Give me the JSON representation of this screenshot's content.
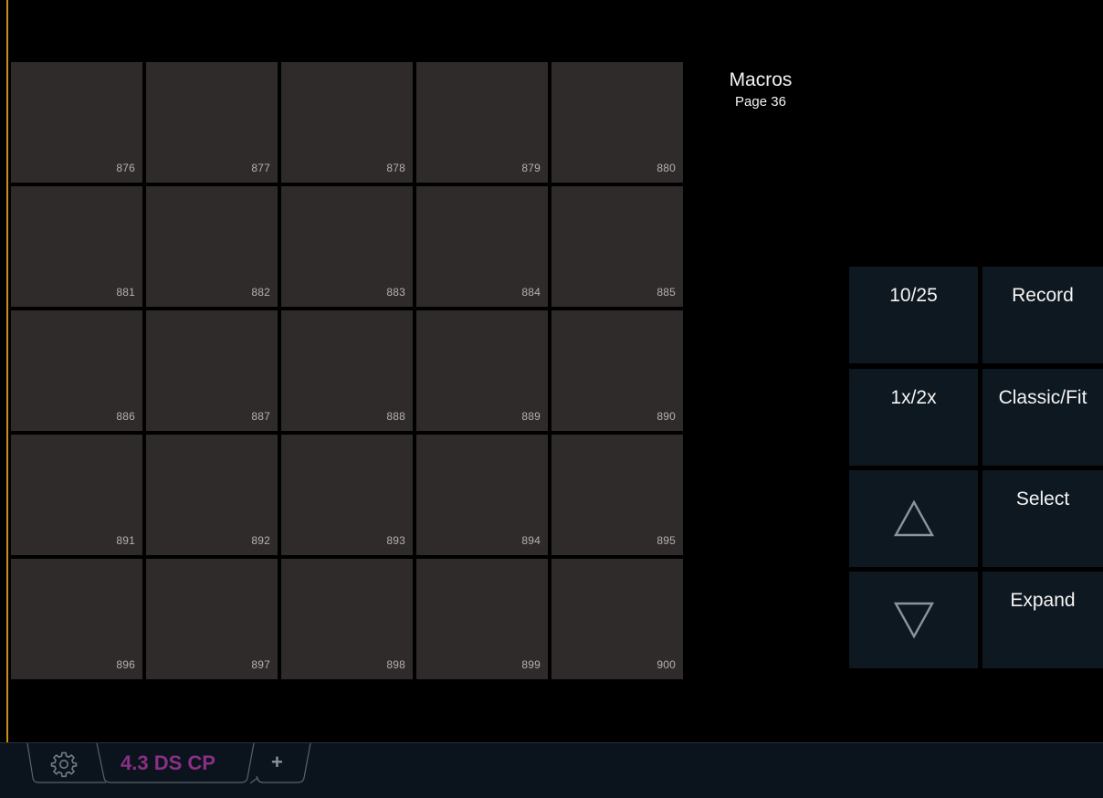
{
  "panel": {
    "title": "Macros",
    "page_label": "Page 36"
  },
  "macros": [
    {
      "number": "876"
    },
    {
      "number": "877"
    },
    {
      "number": "878"
    },
    {
      "number": "879"
    },
    {
      "number": "880"
    },
    {
      "number": "881"
    },
    {
      "number": "882"
    },
    {
      "number": "883"
    },
    {
      "number": "884"
    },
    {
      "number": "885"
    },
    {
      "number": "886"
    },
    {
      "number": "887"
    },
    {
      "number": "888"
    },
    {
      "number": "889"
    },
    {
      "number": "890"
    },
    {
      "number": "891"
    },
    {
      "number": "892"
    },
    {
      "number": "893"
    },
    {
      "number": "894"
    },
    {
      "number": "895"
    },
    {
      "number": "896"
    },
    {
      "number": "897"
    },
    {
      "number": "898"
    },
    {
      "number": "899"
    },
    {
      "number": "900"
    }
  ],
  "controls": {
    "page_count": "10/25",
    "record": "Record",
    "size_toggle": "1x/2x",
    "view_toggle": "Classic/Fit",
    "select": "Select",
    "expand": "Expand",
    "page_up_icon": "triangle-up-icon",
    "page_down_icon": "triangle-down-icon"
  },
  "tabs": {
    "settings_icon": "gear-icon",
    "active_tab_label": "4.3 DS CP",
    "add_tab_label": "+"
  },
  "colors": {
    "tile": "#2f2b2b",
    "control_button": "#0e1820",
    "focus_edge": "#c8901a",
    "active_tab_text": "#8b2f86",
    "tab_bar": "#0b141c"
  }
}
